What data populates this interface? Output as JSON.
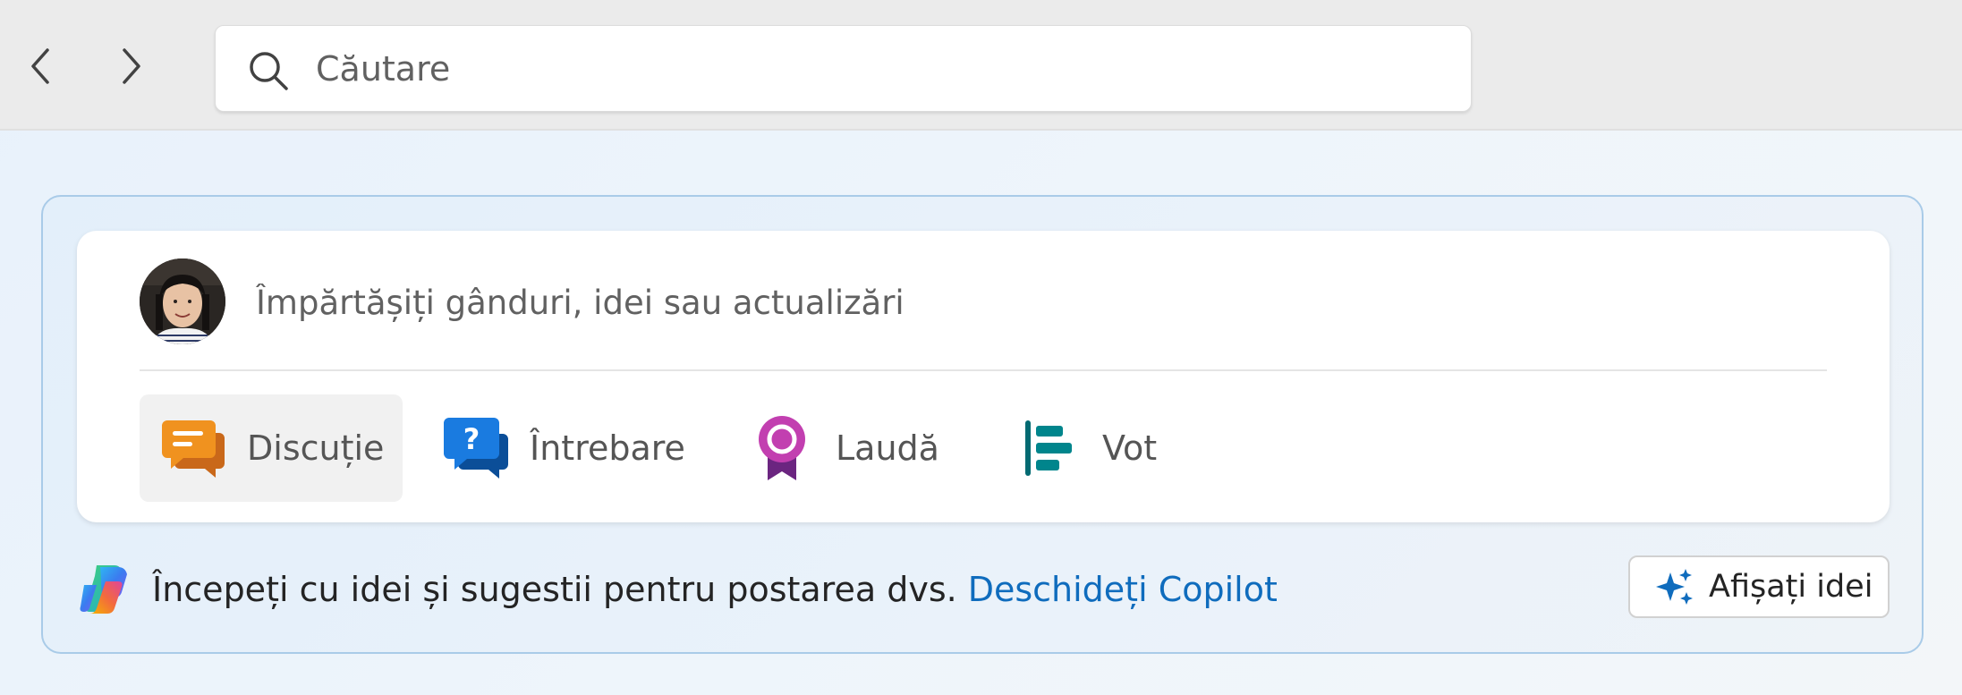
{
  "search": {
    "placeholder": "Căutare"
  },
  "composer": {
    "placeholder": "Împărtășiți gânduri, idei sau actualizări",
    "post_types": [
      {
        "label": "Discuție",
        "icon": "discussion-icon",
        "color": "#f0921f",
        "selected": true
      },
      {
        "label": "Întrebare",
        "icon": "question-icon",
        "color": "#1272d1",
        "selected": false
      },
      {
        "label": "Laudă",
        "icon": "praise-icon",
        "color": "#b4309b",
        "selected": false
      },
      {
        "label": "Vot",
        "icon": "poll-icon",
        "color": "#00828a",
        "selected": false
      }
    ]
  },
  "footer": {
    "text": "Începeți cu idei și sugestii pentru postarea dvs.",
    "link": "Deschideți Copilot",
    "show_ideas_label": "Afișați idei"
  },
  "colors": {
    "link": "#0f6cbd",
    "panel_border": "#a9cbe8",
    "accent_spark": "#0f6cbd"
  }
}
